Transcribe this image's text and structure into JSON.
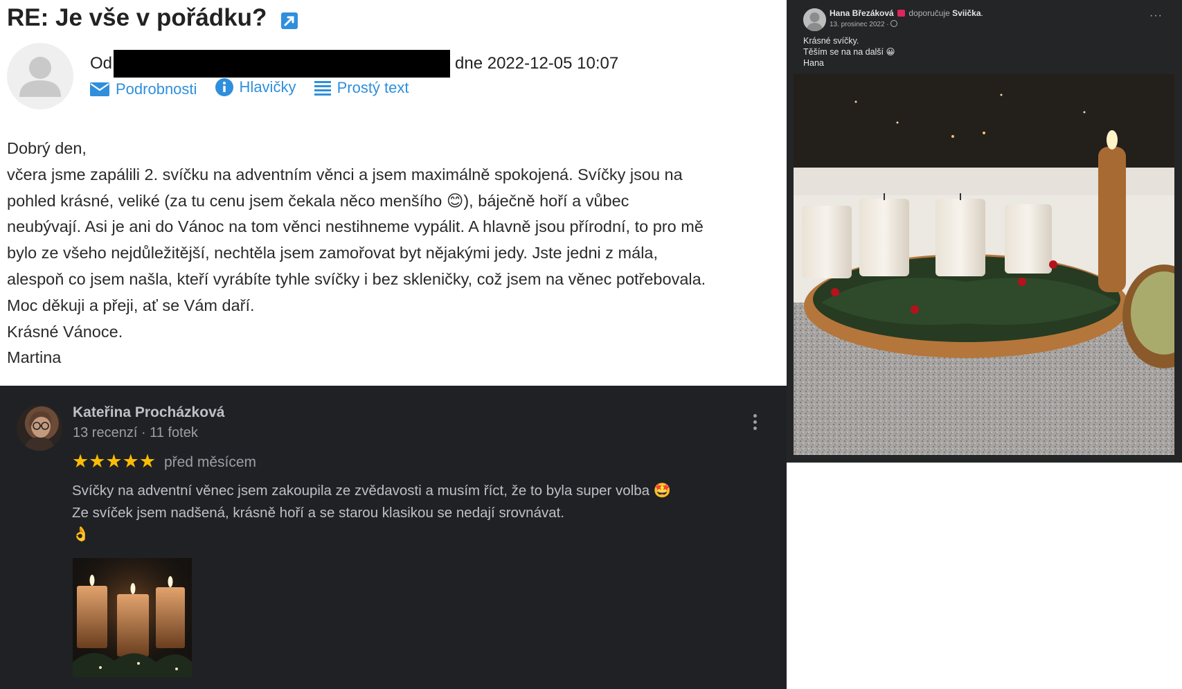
{
  "email": {
    "subject": "RE: Je vše v pořádku?",
    "from_label": "Od",
    "date_text": "dne 2022-12-05 10:07",
    "links": {
      "details": "Podrobnosti",
      "headers": "Hlavičky",
      "plain_text": "Prostý text"
    },
    "body": {
      "greeting": "Dobrý den,",
      "line1": "včera jsme zapálili 2. svíčku na adventním věnci a jsem maximálně spokojená. Svíčky jsou na",
      "line2_a": "pohled krásné, veliké (za tu cenu jsem čekala něco menšího ",
      "line2_emoji": "😊",
      "line2_b": "), báječně hoří a vůbec",
      "line3": "neubývají. Asi je ani do Vánoc na tom věnci nestihneme vypálit. A hlavně jsou přírodní, to pro mě",
      "line4": "bylo ze všeho nejdůležitější, nechtěla jsem zamořovat byt nějakými jedy. Jste jedni z mála,",
      "line5": "alespoň co jsem našla, kteří vyrábíte tyhle svíčky i bez skleničky, což jsem na věnec potřebovala.",
      "line6": "Moc děkuji a přeji, ať se Vám daří.",
      "line7": "Krásné Vánoce.",
      "signature": "Martina"
    }
  },
  "review": {
    "name": "Kateřina Procházková",
    "meta": "13 recenzí · 11 fotek",
    "rating": 5,
    "stars": "★★★★★",
    "when": "před měsícem",
    "text_line1": "Svíčky na adventní věnec jsem zakoupila ze zvědavosti a musím říct, že to byla super volba 🤩",
    "text_line2": "Ze svíček jsem nadšená, krásně hoří a se starou klasikou se nedají srovnávat.",
    "text_line3": "👌"
  },
  "facebook": {
    "author": "Hana Březáková",
    "recommends": "doporučuje",
    "page": "Sviička",
    "page_suffix": ".",
    "date": "13. prosinec 2022 ·",
    "more": "···",
    "text": [
      "Krásné svíčky.",
      "Těším se na na další 😀",
      "Hana"
    ]
  },
  "colors": {
    "link_blue": "#2f8fdc",
    "review_bg": "#202124",
    "star_yellow": "#fbbc04",
    "fb_bg": "#242526"
  },
  "icons": [
    "external-link-icon",
    "envelope-icon",
    "info-icon",
    "list-icon",
    "more-vert-icon",
    "globe-icon",
    "flag-badge-icon"
  ]
}
